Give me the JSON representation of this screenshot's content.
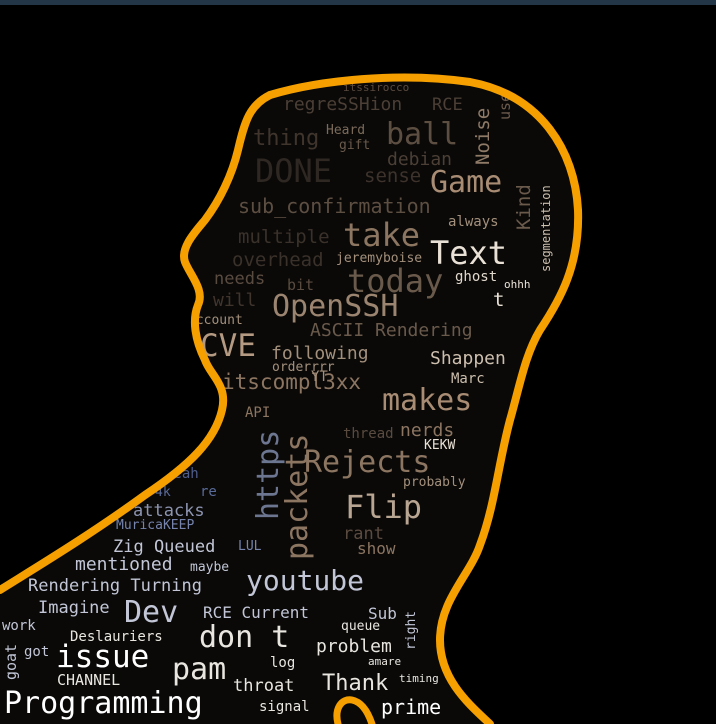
{
  "colors": {
    "background": "#000000",
    "top_bar": "#233648",
    "outline": "#f5a000"
  },
  "words": [
    {
      "text": "itssirocco"
    },
    {
      "text": "regreSSHion"
    },
    {
      "text": "RCE"
    },
    {
      "text": "use"
    },
    {
      "text": "ball"
    },
    {
      "text": "thing"
    },
    {
      "text": "Heard"
    },
    {
      "text": "gift"
    },
    {
      "text": "Noise"
    },
    {
      "text": "debian"
    },
    {
      "text": "DONE"
    },
    {
      "text": "sense"
    },
    {
      "text": "Game"
    },
    {
      "text": "segmentation"
    },
    {
      "text": "sub_confirmation"
    },
    {
      "text": "Kind"
    },
    {
      "text": "always"
    },
    {
      "text": "take"
    },
    {
      "text": "multiple"
    },
    {
      "text": "Text"
    },
    {
      "text": "overhead"
    },
    {
      "text": "jeremyboise"
    },
    {
      "text": "ghost"
    },
    {
      "text": "needs"
    },
    {
      "text": "today"
    },
    {
      "text": "t"
    },
    {
      "text": "ohhh"
    },
    {
      "text": "bit"
    },
    {
      "text": "will"
    },
    {
      "text": "OpenSSH"
    },
    {
      "text": "account"
    },
    {
      "text": "ASCII Rendering"
    },
    {
      "text": "CVE"
    },
    {
      "text": "following"
    },
    {
      "text": "Shappen"
    },
    {
      "text": "orderrrr"
    },
    {
      "text": "itscompl3xx"
    },
    {
      "text": "Marc"
    },
    {
      "text": "makes"
    },
    {
      "text": "API"
    },
    {
      "text": "YT"
    },
    {
      "text": "thread"
    },
    {
      "text": "nerds"
    },
    {
      "text": "KEKW"
    },
    {
      "text": "https"
    },
    {
      "text": "Rejects"
    },
    {
      "text": "yeah"
    },
    {
      "text": "4k"
    },
    {
      "text": "re"
    },
    {
      "text": "probably"
    },
    {
      "text": "packets"
    },
    {
      "text": "attacks"
    },
    {
      "text": "Flip"
    },
    {
      "text": "MuricaKEEP"
    },
    {
      "text": "rant"
    },
    {
      "text": "Zig Queued"
    },
    {
      "text": "LUL"
    },
    {
      "text": "show"
    },
    {
      "text": "mentioned"
    },
    {
      "text": "maybe"
    },
    {
      "text": "Rendering Turning"
    },
    {
      "text": "youtube"
    },
    {
      "text": "Imagine"
    },
    {
      "text": "Dev"
    },
    {
      "text": "RCE Current"
    },
    {
      "text": "Sub"
    },
    {
      "text": "work"
    },
    {
      "text": "queue"
    },
    {
      "text": "Deslauriers"
    },
    {
      "text": "don t"
    },
    {
      "text": "right"
    },
    {
      "text": "goat"
    },
    {
      "text": "got"
    },
    {
      "text": "issue"
    },
    {
      "text": "problem"
    },
    {
      "text": "pam"
    },
    {
      "text": "log"
    },
    {
      "text": "amare"
    },
    {
      "text": "CHANNEL"
    },
    {
      "text": "Thank"
    },
    {
      "text": "throat"
    },
    {
      "text": "timing"
    },
    {
      "text": "Programming"
    },
    {
      "text": "signal"
    },
    {
      "text": "prime"
    }
  ]
}
